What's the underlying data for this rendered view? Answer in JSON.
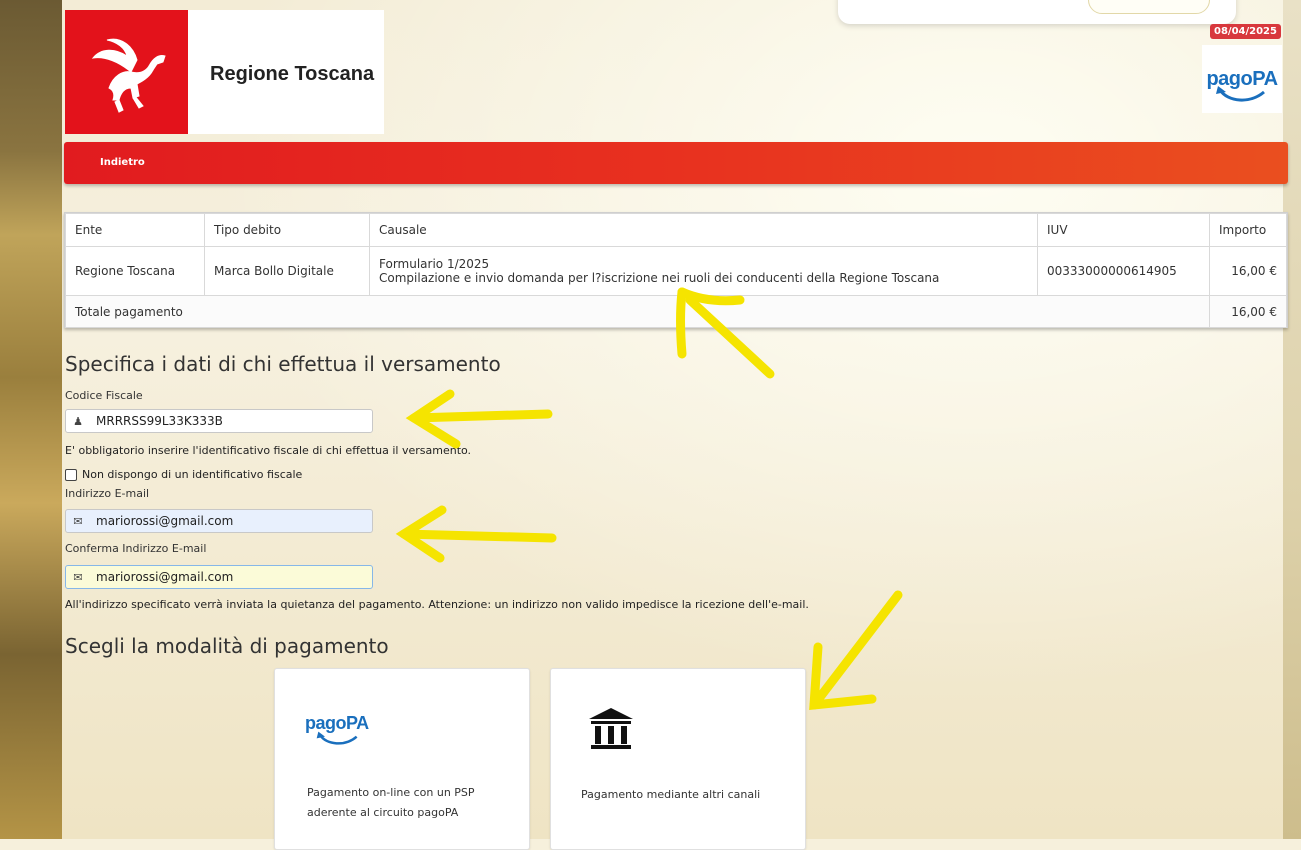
{
  "header": {
    "site_title": "Regione Toscana",
    "date": "08/04/2025",
    "pagopa_logo": "pagoPA"
  },
  "nav": {
    "back_label": "Indietro"
  },
  "table": {
    "headers": [
      "Ente",
      "Tipo debito",
      "Causale",
      "IUV",
      "Importo"
    ],
    "row": {
      "ente": "Regione Toscana",
      "tipo": "Marca Bollo Digitale",
      "causale_line1": "Formulario 1/2025",
      "causale_line2": "Compilazione e invio domanda per l?iscrizione nei ruoli dei conducenti della Regione Toscana",
      "iuv": "00333000000614905",
      "importo": "16,00 €"
    },
    "total_label": "Totale pagamento",
    "total_value": "16,00 €"
  },
  "payer": {
    "title": "Specifica i dati di chi effettua il versamento",
    "cf_label": "Codice Fiscale",
    "cf_value": "MRRRSS99L33K333B",
    "cf_help": "E' obbligatorio inserire l'identificativo fiscale di chi effettua il versamento.",
    "no_cf_label": "Non dispongo di un identificativo fiscale",
    "email_label": "Indirizzo E-mail",
    "email_value": "mariorossi@gmail.com",
    "confirm_label": "Conferma Indirizzo E-mail",
    "confirm_value": "mariorossi@gmail.com",
    "email_help": "All'indirizzo specificato verrà inviata la quietanza del pagamento. Attenzione: un indirizzo non valido impedisce la ricezione dell'e-mail."
  },
  "payment": {
    "title": "Scegli la modalità di pagamento",
    "option1_logo": "pagoPA",
    "option1_line1": "Pagamento on-line con un PSP",
    "option1_line2": "aderente al circuito pagoPA",
    "option2_text": "Pagamento mediante altri canali"
  },
  "colors": {
    "brand_red": "#e3121b",
    "bar_red": "#e11b1f",
    "pagopa_blue": "#1a6fbd",
    "arrow_yellow": "#f5e400"
  },
  "icons": [
    "pegasus-logo-icon",
    "pagopa-logo",
    "user-icon",
    "envelope-icon",
    "bank-icon",
    "yellow-arrow-annotation"
  ]
}
